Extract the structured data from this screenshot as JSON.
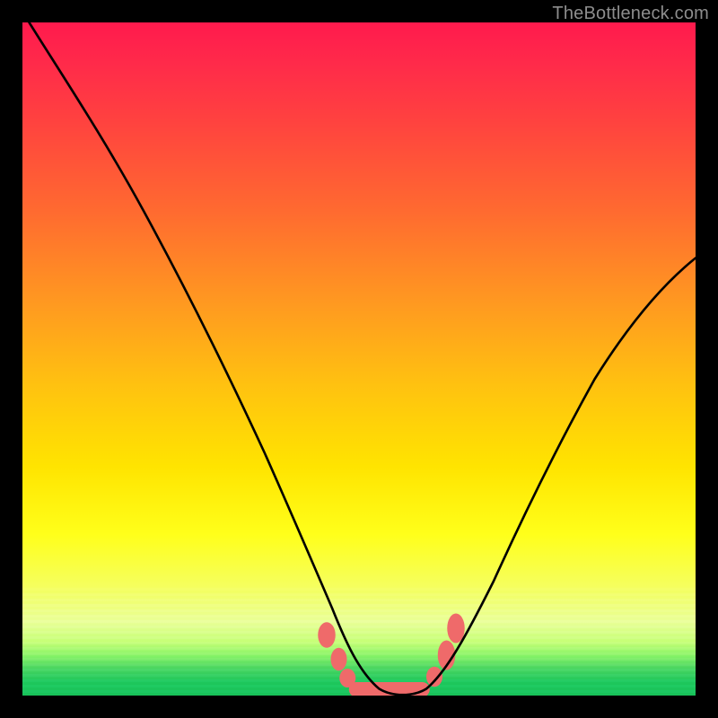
{
  "watermark": "TheBottleneck.com",
  "chart_data": {
    "type": "line",
    "title": "",
    "xlabel": "",
    "ylabel": "",
    "xlim": [
      0,
      100
    ],
    "ylim": [
      0,
      100
    ],
    "legend": false,
    "grid": false,
    "background_gradient": {
      "direction": "vertical",
      "stops": [
        {
          "pos": 0,
          "color": "#ff1a4d"
        },
        {
          "pos": 30,
          "color": "#ff7a28"
        },
        {
          "pos": 60,
          "color": "#ffd400"
        },
        {
          "pos": 85,
          "color": "#f6ff66"
        },
        {
          "pos": 100,
          "color": "#1fc95e"
        }
      ]
    },
    "series": [
      {
        "name": "bottleneck-curve",
        "color": "#000000",
        "x": [
          0,
          5,
          10,
          15,
          20,
          25,
          30,
          35,
          40,
          43,
          46,
          49,
          52,
          55,
          58,
          61,
          64,
          67,
          72,
          77,
          82,
          87,
          92,
          97,
          100
        ],
        "y": [
          100,
          95,
          89,
          82,
          73,
          63,
          52,
          40,
          27,
          19,
          12,
          6,
          2,
          0,
          0,
          1,
          4,
          9,
          19,
          30,
          40,
          49,
          56,
          62,
          65
        ]
      }
    ],
    "markers": {
      "name": "bottom-cluster",
      "color": "#ef6a6a",
      "shape": "rounded-blob",
      "points": [
        {
          "x": 45,
          "y": 9
        },
        {
          "x": 47,
          "y": 5
        },
        {
          "x": 49,
          "y": 1.5
        },
        {
          "x": 52,
          "y": 0.5
        },
        {
          "x": 55,
          "y": 0.2
        },
        {
          "x": 58,
          "y": 0.5
        },
        {
          "x": 61,
          "y": 2
        },
        {
          "x": 63,
          "y": 5
        },
        {
          "x": 64,
          "y": 8
        },
        {
          "x": 65,
          "y": 10
        }
      ]
    }
  }
}
